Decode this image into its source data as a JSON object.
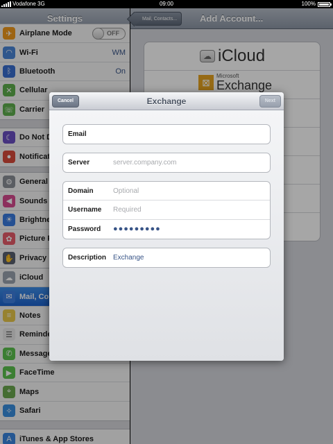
{
  "status_bar": {
    "carrier": "Vodafone 3G",
    "time": "09:00",
    "battery": "100%",
    "battery_level": 1.0
  },
  "settings": {
    "title": "Settings",
    "groups": [
      [
        {
          "label": "Airplane Mode",
          "icon": "airplane-icon",
          "toggle": "OFF"
        },
        {
          "label": "Wi-Fi",
          "icon": "wifi-icon",
          "value": "WM"
        },
        {
          "label": "Bluetooth",
          "icon": "bluetooth-icon",
          "value": "On"
        },
        {
          "label": "Cellular",
          "icon": "cellular-icon"
        },
        {
          "label": "Carrier",
          "icon": "phone-icon"
        }
      ],
      [
        {
          "label": "Do Not D",
          "icon": "moon-icon"
        },
        {
          "label": "Notificat",
          "icon": "notifications-icon"
        }
      ],
      [
        {
          "label": "General",
          "icon": "gear-icon"
        },
        {
          "label": "Sounds",
          "icon": "speaker-icon"
        },
        {
          "label": "Brightne",
          "icon": "brightness-icon"
        },
        {
          "label": "Picture F",
          "icon": "picture-frame-icon"
        },
        {
          "label": "Privacy",
          "icon": "hand-icon"
        }
      ],
      [
        {
          "label": "iCloud",
          "icon": "cloud-icon"
        },
        {
          "label": "Mail, Co",
          "icon": "mail-icon",
          "selected": true
        },
        {
          "label": "Notes",
          "icon": "notes-icon"
        },
        {
          "label": "Reminde",
          "icon": "reminders-icon"
        },
        {
          "label": "Message",
          "icon": "messages-icon"
        },
        {
          "label": "FaceTime",
          "icon": "facetime-icon"
        },
        {
          "label": "Maps",
          "icon": "maps-icon"
        },
        {
          "label": "Safari",
          "icon": "compass-icon"
        }
      ],
      [
        {
          "label": "iTunes & App Stores",
          "icon": "app-store-icon"
        }
      ]
    ]
  },
  "add_account": {
    "back_label": "Mail, Contacts...",
    "title": "Add Account...",
    "providers": [
      {
        "name": "iCloud",
        "type": "icloud"
      },
      {
        "name": "Exchange",
        "prefix": "Microsoft",
        "type": "exchange"
      },
      {
        "type": "blank"
      },
      {
        "type": "blank"
      },
      {
        "type": "blank"
      },
      {
        "type": "blank"
      },
      {
        "type": "blank"
      }
    ]
  },
  "exchange_modal": {
    "title": "Exchange",
    "cancel_label": "Cancel",
    "next_label": "Next",
    "fields": {
      "email": {
        "label": "Email",
        "value": ""
      },
      "server": {
        "label": "Server",
        "placeholder": "server.company.com"
      },
      "domain": {
        "label": "Domain",
        "placeholder": "Optional"
      },
      "username": {
        "label": "Username",
        "placeholder": "Required"
      },
      "password": {
        "label": "Password",
        "value": "●●●●●●●●●"
      },
      "description": {
        "label": "Description",
        "value": "Exchange"
      }
    }
  }
}
